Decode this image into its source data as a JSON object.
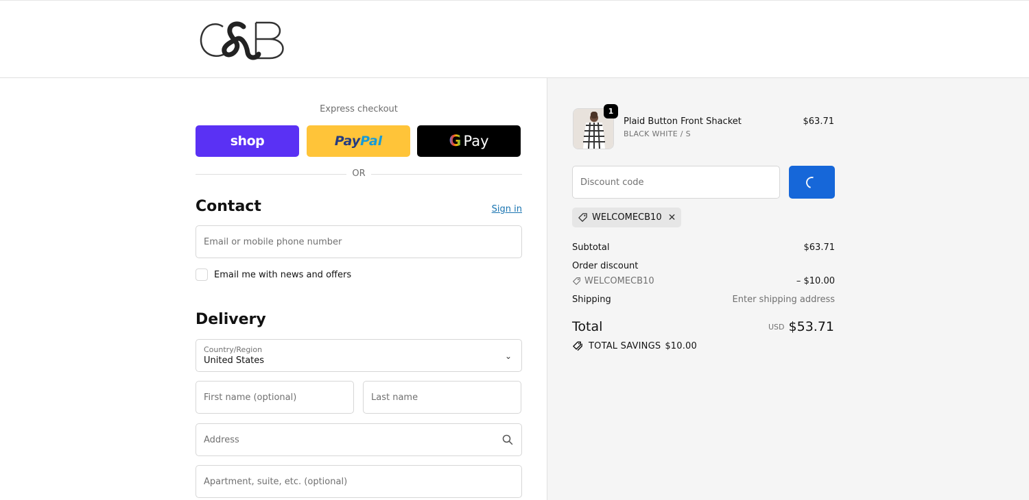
{
  "brand": {
    "logo_text": "C&B"
  },
  "express": {
    "label": "Express checkout",
    "shop_label": "shop",
    "paypal_part1": "Pay",
    "paypal_part2": "Pal",
    "gpay_g": "G",
    "gpay_label": "Pay",
    "or_label": "OR"
  },
  "contact": {
    "title": "Contact",
    "signin_label": "Sign in",
    "email_placeholder": "Email or mobile phone number",
    "newsletter_label": "Email me with news and offers",
    "newsletter_checked": false
  },
  "delivery": {
    "title": "Delivery",
    "country_label": "Country/Region",
    "country_value": "United States",
    "first_name_placeholder": "First name (optional)",
    "last_name_placeholder": "Last name",
    "address_placeholder": "Address",
    "apartment_placeholder": "Apartment, suite, etc. (optional)"
  },
  "order": {
    "item": {
      "name": "Plaid Button Front Shacket",
      "variant": "BLACK WHITE / S",
      "price": "$63.71",
      "quantity": "1"
    },
    "discount_placeholder": "Discount code",
    "applied_code": "WELCOMECB10",
    "subtotal_label": "Subtotal",
    "subtotal_value": "$63.71",
    "order_discount_label": "Order discount",
    "discount_code": "WELCOMECB10",
    "discount_value": "– $10.00",
    "shipping_label": "Shipping",
    "shipping_value": "Enter shipping address",
    "total_label": "Total",
    "currency": "USD",
    "total_value": "$53.71",
    "savings_label": "TOTAL SAVINGS",
    "savings_value": "$10.00"
  },
  "colors": {
    "shop_purple": "#5a31f4",
    "paypal_yellow": "#ffc439",
    "apply_blue": "#1667d9",
    "link_blue": "#1773b0"
  }
}
